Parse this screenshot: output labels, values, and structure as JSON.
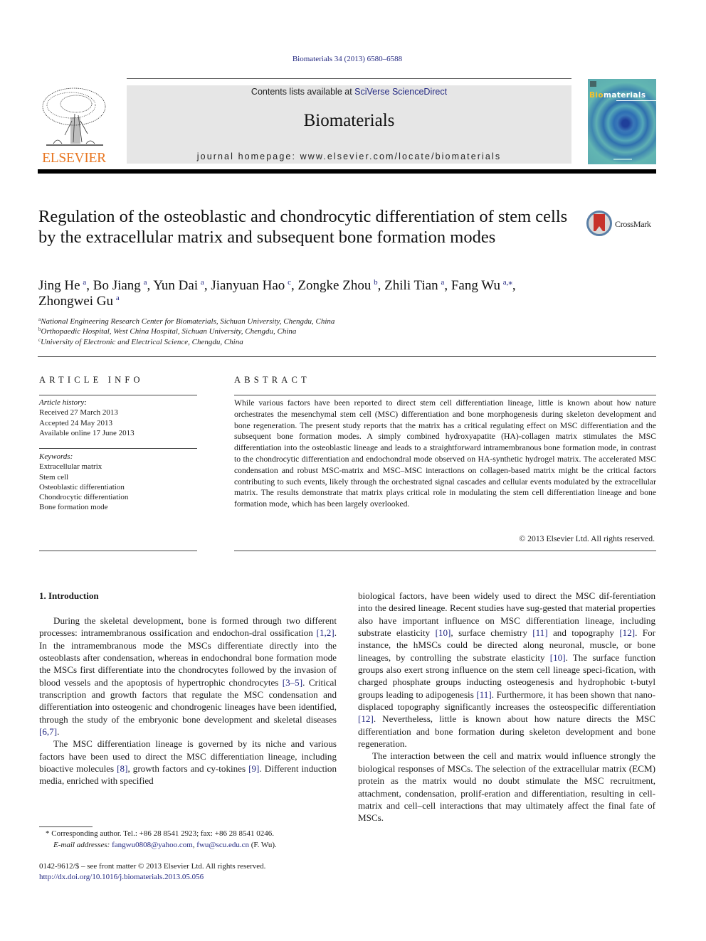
{
  "journal_citation": "Biomaterials 34 (2013) 6580–6588",
  "header": {
    "publisher_logo_text": "ELSEVIER",
    "contents_prefix": "Contents lists available at ",
    "contents_link": "SciVerse ScienceDirect",
    "journal_name": "Biomaterials",
    "homepage": "journal homepage: www.elsevier.com/locate/biomaterials",
    "cover": {
      "title_highlight": "Bio",
      "title_rest": "materials"
    },
    "accent_color": "#e87722",
    "link_color": "#252a82"
  },
  "article": {
    "title": "Regulation of the osteoblastic and chondrocytic differentiation of stem cells by the extracellular matrix and subsequent bone formation modes",
    "crossmark_label": "CrossMark",
    "authors": [
      {
        "name": "Jing He",
        "sup": "a"
      },
      {
        "name": "Bo Jiang",
        "sup": "a"
      },
      {
        "name": "Yun Dai",
        "sup": "a"
      },
      {
        "name": "Jianyuan Hao",
        "sup": "c"
      },
      {
        "name": "Zongke Zhou",
        "sup": "b"
      },
      {
        "name": "Zhili Tian",
        "sup": "a"
      },
      {
        "name": "Fang Wu",
        "sup": "a,⁎"
      },
      {
        "name": "Zhongwei Gu",
        "sup": "a"
      }
    ],
    "affiliations": [
      {
        "key": "a",
        "text": "National Engineering Research Center for Biomaterials, Sichuan University, Chengdu, China"
      },
      {
        "key": "b",
        "text": "Orthopaedic Hospital, West China Hospital, Sichuan University, Chengdu, China"
      },
      {
        "key": "c",
        "text": "University of Electronic and Electrical Science, Chengdu, China"
      }
    ]
  },
  "article_info": {
    "heading": "ARTICLE INFO",
    "history_label": "Article history:",
    "history": [
      "Received 27 March 2013",
      "Accepted 24 May 2013",
      "Available online 17 June 2013"
    ],
    "keywords_label": "Keywords:",
    "keywords": [
      "Extracellular matrix",
      "Stem cell",
      "Osteoblastic differentiation",
      "Chondrocytic differentiation",
      "Bone formation mode"
    ]
  },
  "abstract": {
    "heading": "ABSTRACT",
    "text": "While various factors have been reported to direct stem cell differentiation lineage, little is known about how nature orchestrates the mesenchymal stem cell (MSC) differentiation and bone morphogenesis during skeleton development and bone regeneration. The present study reports that the matrix has a critical regulating effect on MSC differentiation and the subsequent bone formation modes. A simply combined hydroxyapatite (HA)-collagen matrix stimulates the MSC differentiation into the osteoblastic lineage and leads to a straightforward intramembranous bone formation mode, in contrast to the chondrocytic differentiation and endochondral mode observed on HA-synthetic hydrogel matrix. The accelerated MSC condensation and robust MSC-matrix and MSC–MSC interactions on collagen-based matrix might be the critical factors contributing to such events, likely through the orchestrated signal cascades and cellular events modulated by the extracellular matrix. The results demonstrate that matrix plays critical role in modulating the stem cell differentiation lineage and bone formation mode, which has been largely overlooked.",
    "copyright": "© 2013 Elsevier Ltd. All rights reserved."
  },
  "introduction": {
    "heading": "1.  Introduction",
    "left_paragraphs": [
      [
        {
          "t": "During the skeletal development, bone is formed through two different processes: intramembranous ossification and endochon-dral ossification "
        },
        {
          "ref": "[1,2]"
        },
        {
          "t": ". In the intramembranous mode the MSCs differentiate directly into the osteoblasts after condensation, whereas in endochondral bone formation mode the MSCs first differentiate into the chondrocytes followed by the invasion of blood vessels and the apoptosis of hypertrophic chondrocytes "
        },
        {
          "ref": "[3–5]"
        },
        {
          "t": ". Critical transcription and growth factors that regulate the MSC condensation and differentiation into osteogenic and chondrogenic lineages have been identified, through the study of the embryonic bone development and skeletal diseases "
        },
        {
          "ref": "[6,7]"
        },
        {
          "t": "."
        }
      ],
      [
        {
          "t": "The MSC differentiation lineage is governed by its niche and various factors have been used to direct the MSC differentiation lineage, including bioactive molecules "
        },
        {
          "ref": "[8]"
        },
        {
          "t": ", growth factors and cy-tokines "
        },
        {
          "ref": "[9]"
        },
        {
          "t": ". Different induction media, enriched with specified"
        }
      ]
    ],
    "right_paragraphs": [
      [
        {
          "t": "biological factors, have been widely used to direct the MSC dif-ferentiation into the desired lineage. Recent studies have sug-gested that material properties also have important influence on MSC differentiation lineage, including substrate elasticity "
        },
        {
          "ref": "[10]"
        },
        {
          "t": ", surface chemistry "
        },
        {
          "ref": "[11]"
        },
        {
          "t": " and topography "
        },
        {
          "ref": "[12]"
        },
        {
          "t": ". For instance, the hMSCs could be directed along neuronal, muscle, or bone lineages, by controlling the substrate elasticity "
        },
        {
          "ref": "[10]"
        },
        {
          "t": ". The surface function groups also exert strong influence on the stem cell lineage speci-fication, with charged phosphate groups inducting osteogenesis and hydrophobic t-butyl groups leading to adipogenesis "
        },
        {
          "ref": "[11]"
        },
        {
          "t": ". Furthermore, it has been shown that nano-displaced topography significantly increases the osteospecific differentiation "
        },
        {
          "ref": "[12]"
        },
        {
          "t": ". Nevertheless, little is known about how nature directs the MSC differentiation and bone formation during skeleton development and bone regeneration."
        }
      ],
      [
        {
          "t": "The interaction between the cell and matrix would influence strongly the biological responses of MSCs. The selection of the extracellular matrix (ECM) protein as the matrix would no doubt stimulate the MSC recruitment, attachment, condensation, prolif-eration and differentiation, resulting in cell-matrix and cell–cell interactions that may ultimately affect the final fate of MSCs."
        }
      ]
    ]
  },
  "footnote": {
    "marker": "*",
    "corresponding": "Corresponding author. Tel.: +86 28 8541 2923; fax: +86 28 8541 0246.",
    "email_label": "E-mail addresses:",
    "emails": [
      "fangwu0808@yahoo.com",
      "fwu@scu.edu.cn"
    ],
    "email_suffix": " (F. Wu)."
  },
  "issn_line": "0142-9612/$ – see front matter © 2013 Elsevier Ltd. All rights reserved.",
  "doi": "http://dx.doi.org/10.1016/j.biomaterials.2013.05.056"
}
